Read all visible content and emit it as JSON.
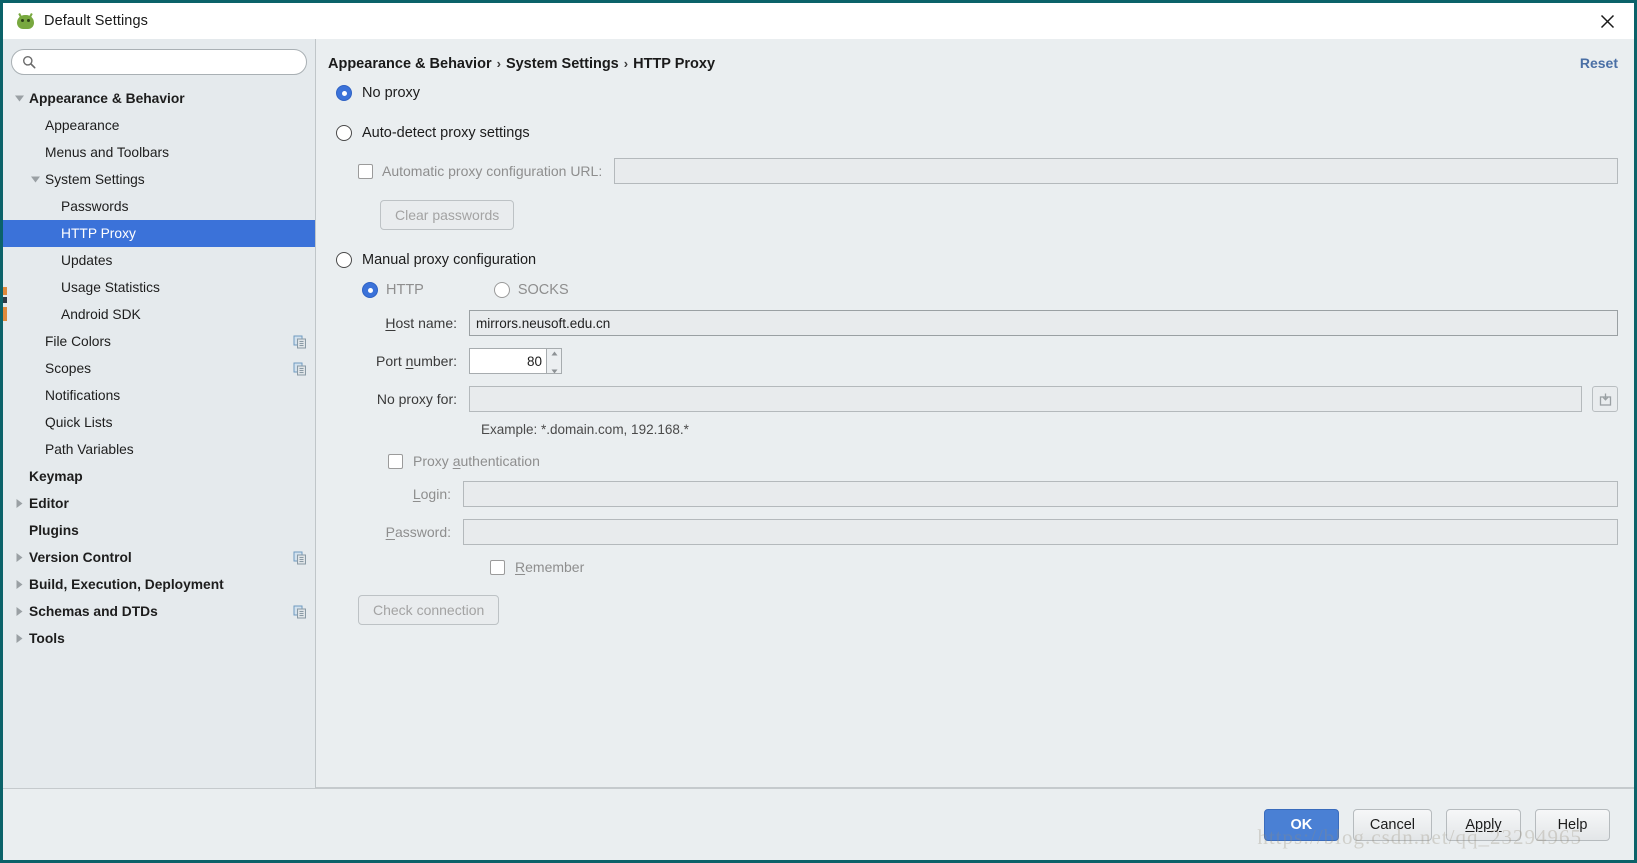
{
  "window": {
    "title": "Default Settings",
    "app_icon": "android-studio-icon",
    "close_icon": "close-icon",
    "accent_color": "#3b72d9",
    "border_color": "#0b6269"
  },
  "sidebar": {
    "search": {
      "value": "",
      "placeholder": "",
      "icon": "search-icon"
    },
    "items": [
      {
        "label": "Appearance & Behavior",
        "indent": 0,
        "bold": true,
        "twisty": "down",
        "selected": false,
        "copy": false
      },
      {
        "label": "Appearance",
        "indent": 1,
        "bold": false,
        "twisty": "none",
        "selected": false,
        "copy": false
      },
      {
        "label": "Menus and Toolbars",
        "indent": 1,
        "bold": false,
        "twisty": "none",
        "selected": false,
        "copy": false
      },
      {
        "label": "System Settings",
        "indent": 1,
        "bold": false,
        "twisty": "down",
        "selected": false,
        "copy": false
      },
      {
        "label": "Passwords",
        "indent": 2,
        "bold": false,
        "twisty": "none",
        "selected": false,
        "copy": false
      },
      {
        "label": "HTTP Proxy",
        "indent": 2,
        "bold": false,
        "twisty": "none",
        "selected": true,
        "copy": false
      },
      {
        "label": "Updates",
        "indent": 2,
        "bold": false,
        "twisty": "none",
        "selected": false,
        "copy": false
      },
      {
        "label": "Usage Statistics",
        "indent": 2,
        "bold": false,
        "twisty": "none",
        "selected": false,
        "copy": false
      },
      {
        "label": "Android SDK",
        "indent": 2,
        "bold": false,
        "twisty": "none",
        "selected": false,
        "copy": false
      },
      {
        "label": "File Colors",
        "indent": 1,
        "bold": false,
        "twisty": "none",
        "selected": false,
        "copy": true
      },
      {
        "label": "Scopes",
        "indent": 1,
        "bold": false,
        "twisty": "none",
        "selected": false,
        "copy": true
      },
      {
        "label": "Notifications",
        "indent": 1,
        "bold": false,
        "twisty": "none",
        "selected": false,
        "copy": false
      },
      {
        "label": "Quick Lists",
        "indent": 1,
        "bold": false,
        "twisty": "none",
        "selected": false,
        "copy": false
      },
      {
        "label": "Path Variables",
        "indent": 1,
        "bold": false,
        "twisty": "none",
        "selected": false,
        "copy": false
      },
      {
        "label": "Keymap",
        "indent": 0,
        "bold": true,
        "twisty": "none",
        "selected": false,
        "copy": false
      },
      {
        "label": "Editor",
        "indent": 0,
        "bold": true,
        "twisty": "right",
        "selected": false,
        "copy": false
      },
      {
        "label": "Plugins",
        "indent": 0,
        "bold": true,
        "twisty": "none",
        "selected": false,
        "copy": false
      },
      {
        "label": "Version Control",
        "indent": 0,
        "bold": true,
        "twisty": "right",
        "selected": false,
        "copy": true
      },
      {
        "label": "Build, Execution, Deployment",
        "indent": 0,
        "bold": true,
        "twisty": "right",
        "selected": false,
        "copy": false
      },
      {
        "label": "Schemas and DTDs",
        "indent": 0,
        "bold": true,
        "twisty": "right",
        "selected": false,
        "copy": true
      },
      {
        "label": "Tools",
        "indent": 0,
        "bold": true,
        "twisty": "right",
        "selected": false,
        "copy": false
      }
    ]
  },
  "header": {
    "breadcrumb": [
      "Appearance & Behavior",
      "System Settings",
      "HTTP Proxy"
    ],
    "separator": "›",
    "reset_label": "Reset"
  },
  "proxy": {
    "no_proxy": {
      "label": "No proxy",
      "selected": true
    },
    "auto_detect": {
      "label": "Auto-detect proxy settings",
      "selected": false
    },
    "auto_url": {
      "label": "Automatic proxy configuration URL:",
      "checked": false,
      "value": "",
      "disabled": true
    },
    "clear_passwords": {
      "label": "Clear passwords",
      "disabled": true
    },
    "manual": {
      "label": "Manual proxy configuration",
      "selected": false
    },
    "protocol": {
      "http": {
        "label": "HTTP",
        "selected": true
      },
      "socks": {
        "label": "SOCKS",
        "selected": false
      }
    },
    "host_name": {
      "label": "Host name:",
      "mnemonic": "H",
      "value": "mirrors.neusoft.edu.cn"
    },
    "port_number": {
      "label": "Port number:",
      "mnemonic": "n",
      "value": "80"
    },
    "no_proxy_for": {
      "label": "No proxy for:",
      "value": "",
      "browse_icon": "expand-editor-icon"
    },
    "example": "Example: *.domain.com, 192.168.*",
    "authentication": {
      "label": "Proxy authentication",
      "mnemonic": "a",
      "checked": false,
      "disabled": true
    },
    "login": {
      "label": "Login:",
      "mnemonic": "L",
      "value": "",
      "disabled": true
    },
    "password": {
      "label": "Password:",
      "mnemonic": "P",
      "value": "",
      "disabled": true
    },
    "remember": {
      "label": "Remember",
      "mnemonic": "R",
      "checked": false,
      "disabled": true
    },
    "check_connection": {
      "label": "Check connection",
      "disabled": true
    }
  },
  "footer": {
    "buttons": [
      {
        "label": "OK",
        "primary": true
      },
      {
        "label": "Cancel",
        "primary": false
      },
      {
        "label": "Apply",
        "primary": false
      },
      {
        "label": "Help",
        "primary": false
      }
    ],
    "watermark": "https://blog.csdn.net/qq_23294965"
  }
}
